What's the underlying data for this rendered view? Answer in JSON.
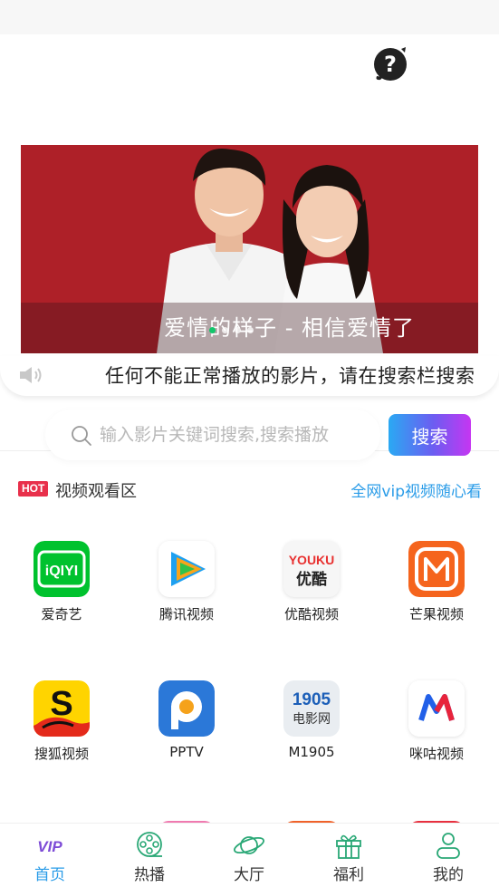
{
  "notice": {
    "text": "任何不能正常播放的影片，请在搜索栏搜索"
  },
  "banner": {
    "caption": "爱情的样子 - 相信爱情了",
    "slide_count": 4,
    "active_slide": 0
  },
  "search": {
    "placeholder": "输入影片关键词搜索,搜索播放",
    "value": "",
    "button_label": "搜索"
  },
  "section": {
    "badge": "HOT",
    "title": "视频观看区",
    "link": "全网vip视频随心看"
  },
  "apps": [
    {
      "label": "爱奇艺",
      "icon": "iqiyi-icon"
    },
    {
      "label": "腾讯视频",
      "icon": "tencent-video-icon"
    },
    {
      "label": "优酷视频",
      "icon": "youku-icon"
    },
    {
      "label": "芒果视频",
      "icon": "mango-tv-icon"
    },
    {
      "label": "搜狐视频",
      "icon": "sohu-video-icon"
    },
    {
      "label": "PPTV",
      "icon": "pptv-icon"
    },
    {
      "label": "M1905",
      "icon": "m1905-icon"
    },
    {
      "label": "咪咕视频",
      "icon": "migu-video-icon"
    }
  ],
  "app_icon_text": {
    "iqiyi": "iQIYI",
    "youku_top": "YOUKU",
    "youku_bottom": "优酷",
    "m1905_top": "1905",
    "m1905_bottom": "电影网"
  },
  "tabs": [
    {
      "label": "首页",
      "icon": "vip-icon",
      "active": true
    },
    {
      "label": "热播",
      "icon": "film-reel-icon",
      "active": false
    },
    {
      "label": "大厅",
      "icon": "planet-icon",
      "active": false
    },
    {
      "label": "福利",
      "icon": "gift-icon",
      "active": false
    },
    {
      "label": "我的",
      "icon": "user-icon",
      "active": false
    }
  ],
  "tab_icon_text": {
    "vip": "VIP"
  },
  "colors": {
    "accent": "#2a9ce8",
    "hot": "#e8304b",
    "banner_bg": "#b3222a",
    "active_dot": "#11c66b"
  }
}
